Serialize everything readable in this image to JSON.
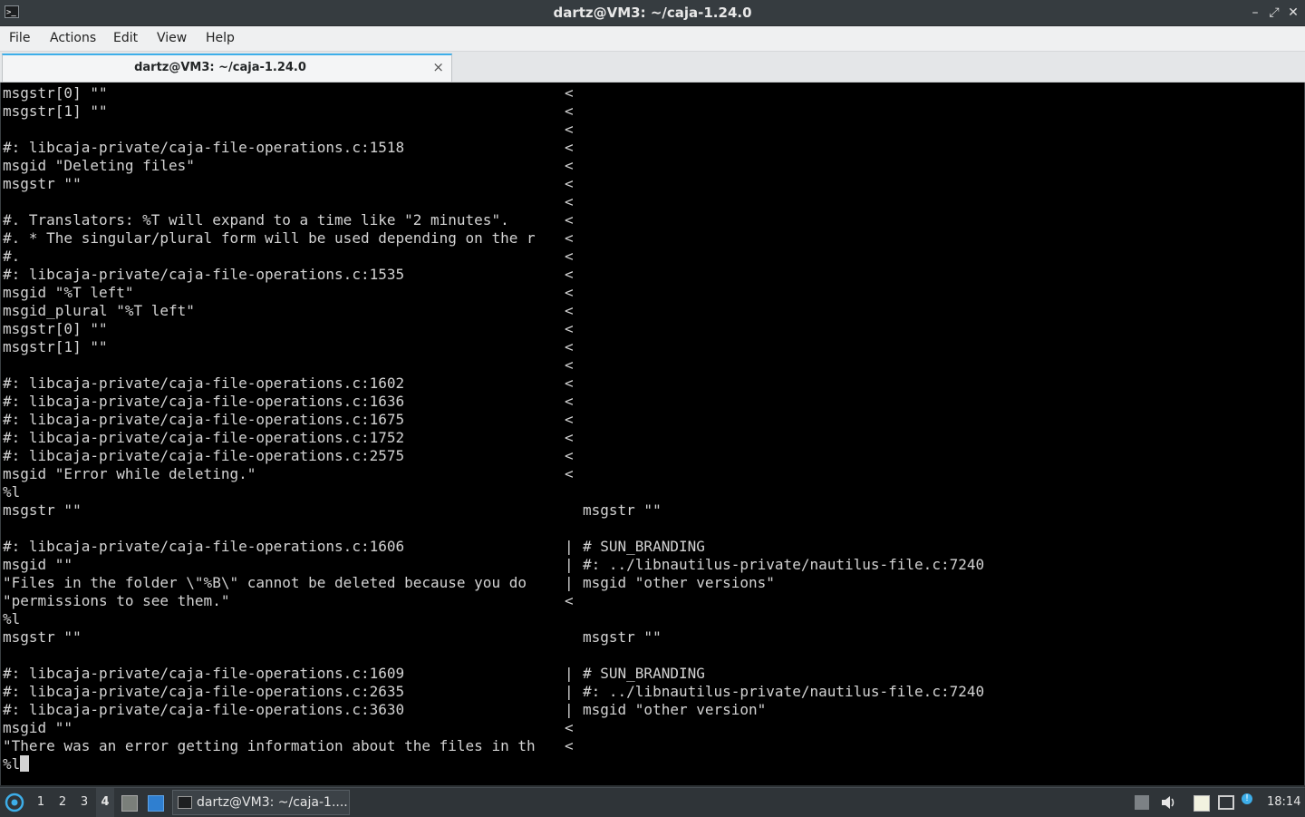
{
  "window": {
    "title": "dartz@VM3: ~/caja-1.24.0",
    "app_icon_text": ">_",
    "minimize_glyph": "–",
    "maximize_glyph": "⤢",
    "close_glyph": "✕"
  },
  "menu": {
    "items": [
      "File",
      "Actions",
      "Edit",
      "View",
      "Help"
    ]
  },
  "tab": {
    "label": "dartz@VM3: ~/caja-1.24.0",
    "close_glyph": "×"
  },
  "terminal": {
    "lines": [
      {
        "left": "msgstr[0] \"\"",
        "mid": "<",
        "right": ""
      },
      {
        "left": "msgstr[1] \"\"",
        "mid": "<",
        "right": ""
      },
      {
        "left": "",
        "mid": "<",
        "right": ""
      },
      {
        "left": "#: libcaja-private/caja-file-operations.c:1518",
        "mid": "<",
        "right": ""
      },
      {
        "left": "msgid \"Deleting files\"",
        "mid": "<",
        "right": ""
      },
      {
        "left": "msgstr \"\"",
        "mid": "<",
        "right": ""
      },
      {
        "left": "",
        "mid": "<",
        "right": ""
      },
      {
        "left": "#. Translators: %T will expand to a time like \"2 minutes\".",
        "mid": "<",
        "right": ""
      },
      {
        "left": "#. * The singular/plural form will be used depending on the r",
        "mid": "<",
        "right": ""
      },
      {
        "left": "#.",
        "mid": "<",
        "right": ""
      },
      {
        "left": "#: libcaja-private/caja-file-operations.c:1535",
        "mid": "<",
        "right": ""
      },
      {
        "left": "msgid \"%T left\"",
        "mid": "<",
        "right": ""
      },
      {
        "left": "msgid_plural \"%T left\"",
        "mid": "<",
        "right": ""
      },
      {
        "left": "msgstr[0] \"\"",
        "mid": "<",
        "right": ""
      },
      {
        "left": "msgstr[1] \"\"",
        "mid": "<",
        "right": ""
      },
      {
        "left": "",
        "mid": "<",
        "right": ""
      },
      {
        "left": "#: libcaja-private/caja-file-operations.c:1602",
        "mid": "<",
        "right": ""
      },
      {
        "left": "#: libcaja-private/caja-file-operations.c:1636",
        "mid": "<",
        "right": ""
      },
      {
        "left": "#: libcaja-private/caja-file-operations.c:1675",
        "mid": "<",
        "right": ""
      },
      {
        "left": "#: libcaja-private/caja-file-operations.c:1752",
        "mid": "<",
        "right": ""
      },
      {
        "left": "#: libcaja-private/caja-file-operations.c:2575",
        "mid": "<",
        "right": ""
      },
      {
        "left": "msgid \"Error while deleting.\"",
        "mid": "<",
        "right": ""
      },
      {
        "left": "%l",
        "mid": "",
        "right": ""
      },
      {
        "left": "msgstr \"\"",
        "mid": "",
        "right": "msgstr \"\""
      },
      {
        "left": "",
        "mid": "",
        "right": ""
      },
      {
        "left": "#: libcaja-private/caja-file-operations.c:1606",
        "mid": "|",
        "right": "# SUN_BRANDING"
      },
      {
        "left": "msgid \"\"",
        "mid": "|",
        "right": "#: ../libnautilus-private/nautilus-file.c:7240"
      },
      {
        "left": "\"Files in the folder \\\"%B\\\" cannot be deleted because you do",
        "mid": "|",
        "right": "msgid \"other versions\""
      },
      {
        "left": "\"permissions to see them.\"",
        "mid": "<",
        "right": ""
      },
      {
        "left": "%l",
        "mid": "",
        "right": ""
      },
      {
        "left": "msgstr \"\"",
        "mid": "",
        "right": "msgstr \"\""
      },
      {
        "left": "",
        "mid": "",
        "right": ""
      },
      {
        "left": "#: libcaja-private/caja-file-operations.c:1609",
        "mid": "|",
        "right": "# SUN_BRANDING"
      },
      {
        "left": "#: libcaja-private/caja-file-operations.c:2635",
        "mid": "|",
        "right": "#: ../libnautilus-private/nautilus-file.c:7240"
      },
      {
        "left": "#: libcaja-private/caja-file-operations.c:3630",
        "mid": "|",
        "right": "msgid \"other version\""
      },
      {
        "left": "msgid \"\"",
        "mid": "<",
        "right": ""
      },
      {
        "left": "\"There was an error getting information about the files in th",
        "mid": "<",
        "right": ""
      },
      {
        "left": "%l",
        "mid": "",
        "right": "",
        "cursor": true
      }
    ]
  },
  "taskbar": {
    "workspaces": [
      "1",
      "2",
      "3",
      "4"
    ],
    "active_workspace": "4",
    "task_label": "dartz@VM3: ~/caja-1....",
    "clock": "18:14",
    "notification_badge": "!"
  }
}
